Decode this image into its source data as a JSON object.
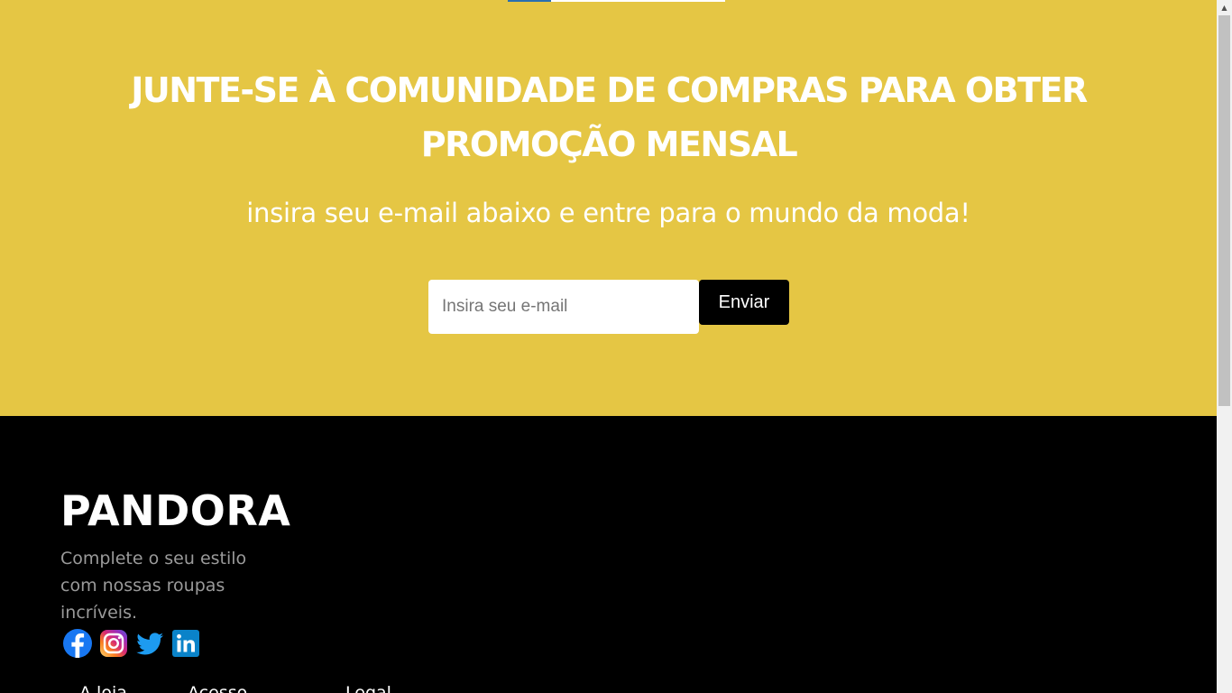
{
  "newsletter": {
    "headline": "JUNTE-SE À COMUNIDADE DE COMPRAS PARA OBTER PROMOÇÃO MENSAL",
    "subheadline": "insira seu e-mail abaixo e entre para o mundo da moda!",
    "email_placeholder": "Insira seu e-mail",
    "email_value": "",
    "send_label": "Enviar",
    "background_color": "#e5c644",
    "button_color": "#000000"
  },
  "footer": {
    "brand": "PANDORA",
    "tagline": "Complete o seu estilo com nossas roupas incríveis.",
    "socials": [
      "facebook-icon",
      "instagram-icon",
      "twitter-icon",
      "linkedin-icon"
    ],
    "nav": [
      "A loja",
      "Acesso",
      "Legal"
    ],
    "background_color": "#000000",
    "tagline_color": "#9a9a9a"
  },
  "scrollbar": {
    "up_arrow_icon": "chevron-up-icon"
  }
}
